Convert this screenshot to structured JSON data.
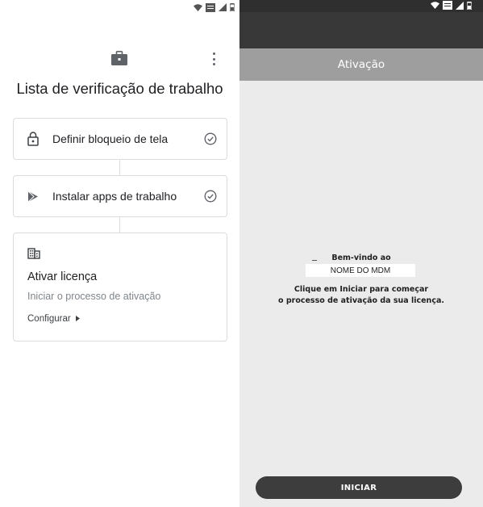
{
  "left": {
    "status_icons": [
      "wifi-icon",
      "lte-icon",
      "signal-icon",
      "battery-icon"
    ],
    "header_icon": "briefcase-icon",
    "menu_icon": "more-vert-icon",
    "title": "Lista de verificação de trabalho",
    "tasks": [
      {
        "label": "Definir bloqueio de tela",
        "icon": "lock-icon",
        "status_icon": "check-circle-icon"
      },
      {
        "label": "Instalar apps de trabalho",
        "icon": "play-store-icon",
        "status_icon": "check-circle-icon"
      }
    ],
    "license_card": {
      "icon": "building-icon",
      "title": "Ativar licença",
      "subtitle": "Iniciar o processo de ativação",
      "action_label": "Configurar",
      "action_icon": "arrow-right-icon"
    }
  },
  "right": {
    "status_icons": [
      "wifi-icon",
      "lte-icon",
      "signal-icon",
      "battery-icon"
    ],
    "toolbar_title": "Ativação",
    "welcome_line": "Bem-vindo ao",
    "mdm_name": "NOME DO MDM",
    "instruction_line1": "Clique em Iniciar para começar",
    "instruction_line2": "o processo de ativação da sua licença.",
    "start_button": "INICIAR"
  },
  "colors": {
    "card_border": "#dadce0",
    "right_bg": "#ebebeb",
    "toolbar": "#9e9e9e",
    "appbar": "#383838",
    "button": "#3d3d3d"
  }
}
